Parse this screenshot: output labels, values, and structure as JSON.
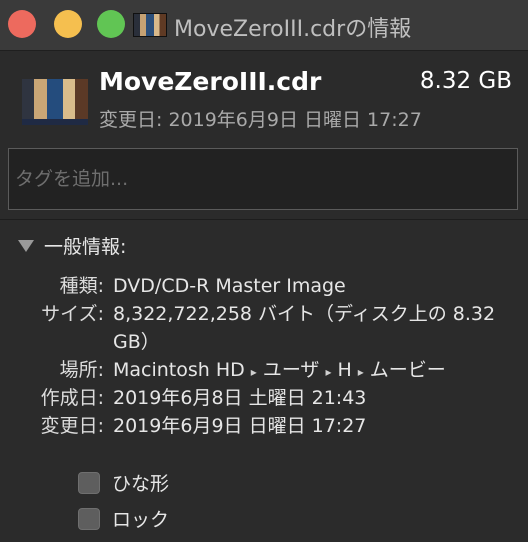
{
  "window": {
    "title": "MoveZeroIII.cdrの情報"
  },
  "header": {
    "file_name": "MoveZeroIII.cdr",
    "file_size": "8.32 GB",
    "modified_line": "変更日: 2019年6月9日 日曜日 17:27"
  },
  "tags": {
    "placeholder": "タグを追加..."
  },
  "general": {
    "title": "一般情報:",
    "kind_label": "種類:",
    "kind_value": "DVD/CD-R Master Image",
    "size_label": "サイズ:",
    "size_value": "8,322,722,258 バイト（ディスク上の 8.32 GB）",
    "where_label": "場所:",
    "where_path": [
      "Macintosh HD",
      "ユーザ",
      "H",
      "ムービー"
    ],
    "where_separator": "▸",
    "created_label": "作成日:",
    "created_value": "2019年6月8日 土曜日 21:43",
    "modified_label": "変更日:",
    "modified_value": "2019年6月9日 日曜日 17:27"
  },
  "options": {
    "stationery_label": "ひな形",
    "locked_label": "ロック"
  },
  "colors": {
    "close": "#ed6a5e",
    "minimize": "#f5bf4f",
    "maximize": "#61c554",
    "background": "#2b2b2b"
  }
}
